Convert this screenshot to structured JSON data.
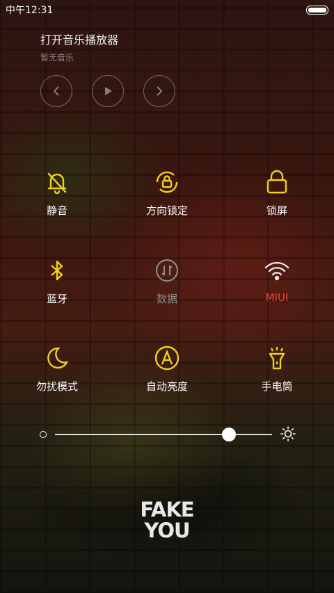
{
  "status": {
    "time": "中午12:31"
  },
  "music": {
    "title": "打开音乐播放器",
    "subtitle": "暂无音乐",
    "controls": [
      "previous-icon",
      "play-icon",
      "next-icon"
    ]
  },
  "toggles": [
    {
      "id": "mute",
      "label": "静音",
      "icon": "bell-off-icon",
      "state": "on",
      "color": "#f2d21a"
    },
    {
      "id": "rotation",
      "label": "方向锁定",
      "icon": "rotation-lock-icon",
      "state": "on",
      "color": "#f2d21a"
    },
    {
      "id": "lock",
      "label": "锁屏",
      "icon": "lock-icon",
      "state": "on",
      "color": "#f2d21a"
    },
    {
      "id": "bluetooth",
      "label": "蓝牙",
      "icon": "bluetooth-icon",
      "state": "on",
      "color": "#f2d21a"
    },
    {
      "id": "data",
      "label": "数据",
      "icon": "mobile-data-icon",
      "state": "off",
      "color": "#8a8a8a"
    },
    {
      "id": "wifi",
      "label": "MIUI",
      "icon": "wifi-icon",
      "state": "connected",
      "color": "#e8473b"
    },
    {
      "id": "dnd",
      "label": "勿扰模式",
      "icon": "moon-icon",
      "state": "on",
      "color": "#f2d21a"
    },
    {
      "id": "auto-brightness",
      "label": "自动亮度",
      "icon": "auto-brightness-icon",
      "state": "on",
      "color": "#f2d21a"
    },
    {
      "id": "flashlight",
      "label": "手电筒",
      "icon": "flashlight-icon",
      "state": "on",
      "color": "#f2d21a"
    }
  ],
  "brightness": {
    "level": 0.8
  },
  "wallpaper": {
    "text_line1": "FAKE",
    "text_line2": "YOU"
  },
  "colors": {
    "accent": "#f2d21a",
    "wifi_label": "#e8473b",
    "inactive": "#8a8a8a"
  }
}
